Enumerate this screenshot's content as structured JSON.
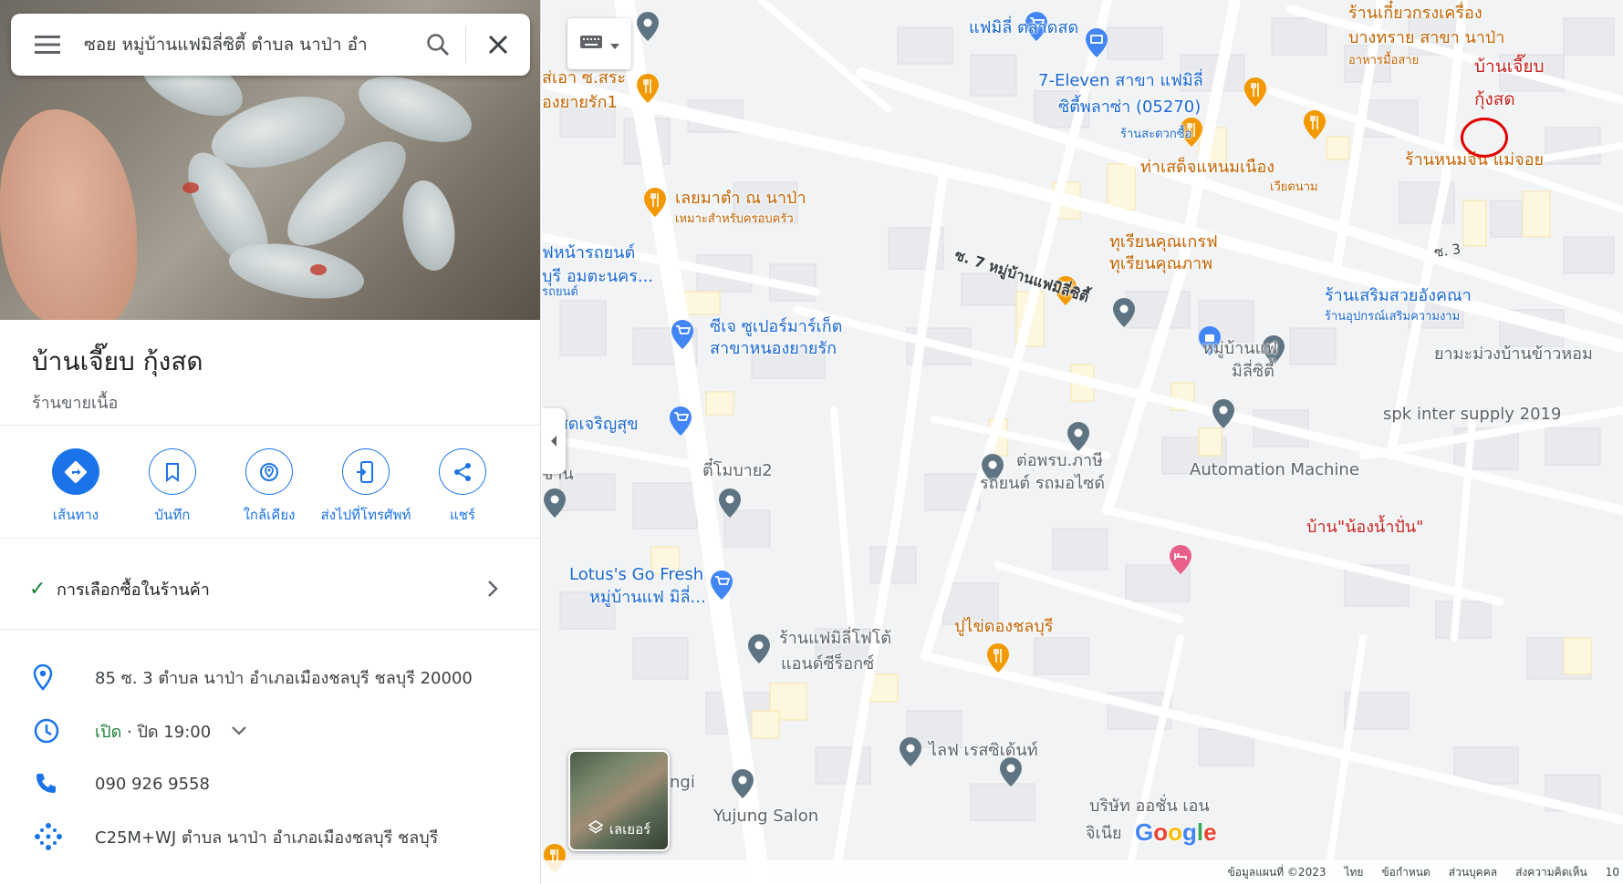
{
  "search": {
    "query": "ซอย หมู่บ้านแฟมิลี่ซิตี้ ตำบล นาป่า อำ"
  },
  "place": {
    "title": "บ้านเจี๊ยบ กุ้งสด",
    "category": "ร้านขายเนื้อ"
  },
  "actions": [
    {
      "label": "เส้นทาง",
      "icon": "directions-icon"
    },
    {
      "label": "บันทึก",
      "icon": "bookmark-icon"
    },
    {
      "label": "ใกล้เคียง",
      "icon": "nearby-icon"
    },
    {
      "label": "ส่งไปที่โทรศัพท์",
      "icon": "send-to-phone-icon"
    },
    {
      "label": "แชร์",
      "icon": "share-icon"
    }
  ],
  "shopping_option": "การเลือกซื้อในร้านค้า",
  "info": {
    "address": "85 ซ. 3 ตำบล นาป่า อำเภอเมืองชลบุรี ชลบุรี 20000",
    "hours_open": "เปิด",
    "hours_rest": "· ปิด 19:00",
    "phone": "090 926 9558",
    "plus_code": "C25M+WJ ตำบล นาป่า อำเภอเมืองชลบุรี ชลบุรี"
  },
  "map": {
    "labels": [
      {
        "text": "แฟมิลี่ ตลาดสด",
        "color": "blue"
      },
      {
        "text": "7-Eleven สาขา แฟมิลี่",
        "color": "blue"
      },
      {
        "text": "ซิตี้พลาซ่า (05270)",
        "color": "blue"
      },
      {
        "text": "ร้านสะดวกซื้อ",
        "color": "blue",
        "small": true
      },
      {
        "text": "ร้านเกี๋ยวกรงเครื่อง",
        "color": "orange"
      },
      {
        "text": "บางทราย สาขา นาป่า",
        "color": "orange"
      },
      {
        "text": "อาหารมื้อสาย",
        "color": "orange",
        "small": true
      },
      {
        "text": "ท่าเสด็จแหนมเนือง",
        "color": "orange"
      },
      {
        "text": "เวียดนาม",
        "color": "orange",
        "small": true
      },
      {
        "text": "ร้านหนมจีน แม่จอย",
        "color": "orange"
      },
      {
        "text": "ส่เอา ซ.สระ",
        "color": "orange"
      },
      {
        "text": "องยายรัก1",
        "color": "orange"
      },
      {
        "text": "เลยมาตำ ณ นาป่า",
        "color": "orange"
      },
      {
        "text": "เหมาะสำหรับครอบครัว",
        "color": "orange",
        "small": true
      },
      {
        "text": "ฟหน้ารถยนต์",
        "color": "blue"
      },
      {
        "text": "บุรี อมตะนคร...",
        "color": "blue"
      },
      {
        "text": "รถยนต์",
        "color": "blue",
        "small": true
      },
      {
        "text": "ซ. 7 หมู่บ้านแฟมิลี่ซิตี้",
        "color": "dark"
      },
      {
        "text": "ทุเรียนคุณเกรฟ",
        "color": "orange"
      },
      {
        "text": "ทุเรียนคุณภาพ",
        "color": "orange"
      },
      {
        "text": "ซ. 3",
        "color": "dark"
      },
      {
        "text": "ร้านเสริมสวยอังคณา",
        "color": "blue"
      },
      {
        "text": "ร้านอุปกรณ์เสริมความงาม",
        "color": "blue",
        "small": true
      },
      {
        "text": "ยามะม่วงบ้านข้าวหอม",
        "color": "gray"
      },
      {
        "text": "ซีเจ ซูเปอร์มาร์เก็ต",
        "color": "blue"
      },
      {
        "text": "สาขาหนองยายรัก",
        "color": "blue"
      },
      {
        "text": "หมู่บ้านแฟ",
        "color": "gray"
      },
      {
        "text": "มิลี่ซิตี้",
        "color": "gray"
      },
      {
        "text": "spk inter supply 2019",
        "color": "gray"
      },
      {
        "text": "เดสดเจริญสุข",
        "color": "blue"
      },
      {
        "text": "ต่อพรบ.ภาษี",
        "color": "gray"
      },
      {
        "text": "รถยนต์ รถมอไซด์",
        "color": "gray"
      },
      {
        "text": "Automation Machine",
        "color": "gray"
      },
      {
        "text": "ตี๋โมบาย2",
        "color": "gray"
      },
      {
        "text": "บ้าน\"น้องน้ำปั่น\"",
        "color": "red"
      },
      {
        "text": "ข้าน",
        "color": "gray"
      },
      {
        "text": "Lotus's Go Fresh",
        "color": "blue"
      },
      {
        "text": "หมู่บ้านแฟ มิลี่...",
        "color": "blue"
      },
      {
        "text": "ปูไข่ดองชลบุรี",
        "color": "orange"
      },
      {
        "text": "ร้านแฟมิลี่โฟโต้",
        "color": "gray"
      },
      {
        "text": "แอนด์ซีร็อกซ์",
        "color": "gray"
      },
      {
        "text": "ไลฟ เรสซิเด้นท์",
        "color": "gray"
      },
      {
        "text": "ngi",
        "color": "gray"
      },
      {
        "text": "Yujung Salon",
        "color": "gray"
      },
      {
        "text": "บริษัท ออชั่น เอน",
        "color": "gray"
      },
      {
        "text": "จิเนีย",
        "color": "gray"
      }
    ],
    "annotation": {
      "line1": "บ้านเจี๊ยบ",
      "line2": "กุ้งสด"
    },
    "layers_label": "เลเยอร์",
    "google": [
      "G",
      "o",
      "o",
      "g",
      "l",
      "e"
    ],
    "google_colors": [
      "#4285F4",
      "#EA4335",
      "#FBBC05",
      "#4285F4",
      "#34A853",
      "#EA4335"
    ],
    "attribution": [
      "ข้อมูลแผนที่ ©2023",
      "ไทย",
      "ข้อกำหนด",
      "ส่วนบุคคล",
      "ส่งความคิดเห็น",
      "10"
    ]
  }
}
